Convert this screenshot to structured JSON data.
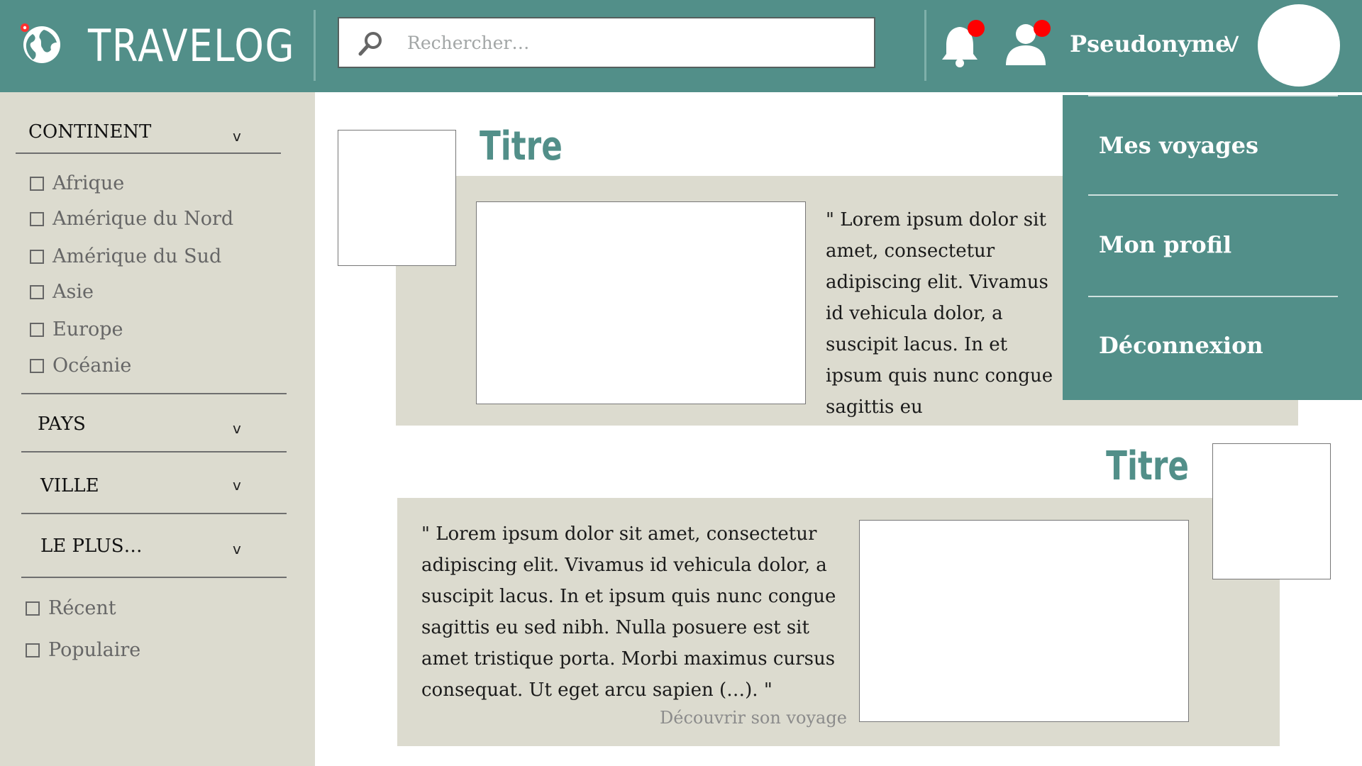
{
  "header": {
    "logo_text": "TRAVELOG",
    "logo_icon": "globe-pin-icon",
    "search_placeholder": "Rechercher…",
    "search_icon": "search-icon",
    "notification_icon": "bell-icon",
    "friends_icon": "user-icon",
    "username": "Pseudonyme",
    "username_caret": "V"
  },
  "sidebar": {
    "continent": {
      "label": "CONTINENT",
      "caret": "v",
      "options": [
        "Afrique",
        "Amérique du Nord",
        "Amérique du Sud",
        "Asie",
        "Europe",
        "Océanie"
      ]
    },
    "pays": {
      "label": "PAYS",
      "caret": "v"
    },
    "ville": {
      "label": "VILLE",
      "caret": "v"
    },
    "le_plus": {
      "label": "LE PLUS…",
      "caret": "v",
      "options": [
        "Récent",
        "Populaire"
      ]
    }
  },
  "posts": [
    {
      "title": "Titre",
      "excerpt": "\" Lorem ipsum dolor sit amet, consectetur adipiscing elit. Vivamus id vehicula dolor, a suscipit lacus. In et ipsum quis nunc congue sagittis eu"
    },
    {
      "title": "Titre",
      "excerpt": "\" Lorem ipsum dolor sit amet, consectetur adipiscing elit. Vivamus id vehicula dolor, a suscipit lacus. In et ipsum quis nunc congue sagittis eu sed nibh. Nulla posuere est sit amet tristique porta. Morbi maximus cursus consequat. Ut eget arcu sapien (…). \"",
      "link": "Découvrir son voyage"
    }
  ],
  "user_menu": {
    "items": [
      "Mes voyages",
      "Mon profil",
      "Déconnexion"
    ]
  },
  "colors": {
    "brand": "#528f89",
    "panel": "#dcdbcf",
    "notification": "#ff0000"
  }
}
